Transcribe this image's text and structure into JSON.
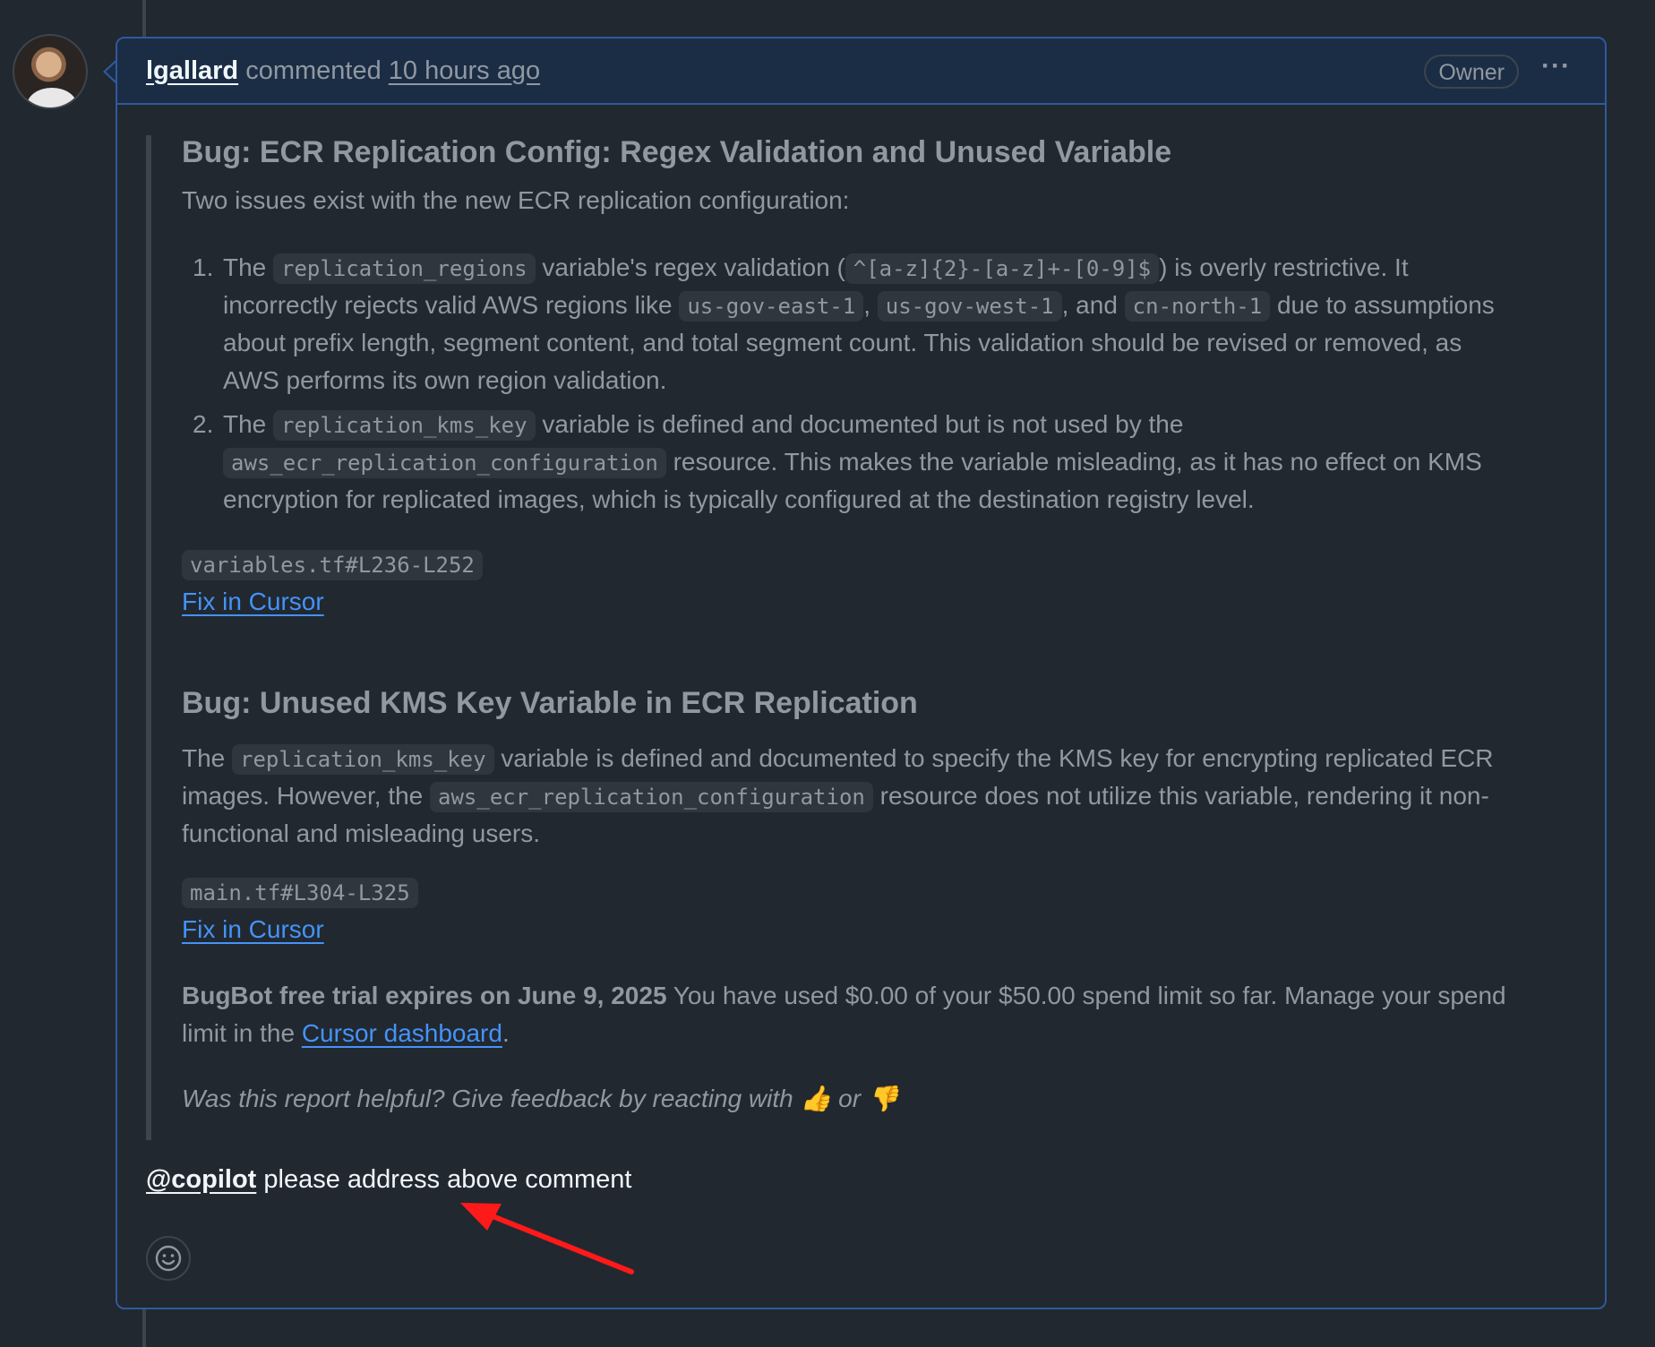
{
  "header": {
    "author": "lgallard",
    "action": "commented",
    "time": "10 hours ago",
    "badge": "Owner",
    "menu_glyph": "···"
  },
  "bug1": {
    "title": "Bug: ECR Replication Config: Regex Validation and Unused Variable",
    "intro": "Two issues exist with the new ECR replication configuration:",
    "item1": {
      "num": "1.",
      "l1_a": "The ",
      "l1_code1": "replication_regions",
      "l1_b": " variable's regex validation (",
      "l1_code2": "^[a-z]{2}-[a-z]+-[0-9]$",
      "l1_c": ") is overly restrictive. It",
      "l2_a": "incorrectly rejects valid AWS regions like ",
      "l2_code1": "us-gov-east-1",
      "l2_b": ", ",
      "l2_code2": "us-gov-west-1",
      "l2_c": ", and ",
      "l2_code3": "cn-north-1",
      "l2_d": " due to assumptions",
      "l3": "about prefix length, segment content, and total segment count. This validation should be revised or removed, as",
      "l4": "AWS performs its own region validation."
    },
    "item2": {
      "num": "2.",
      "l1_a": "The ",
      "l1_code": "replication_kms_key",
      "l1_b": " variable is defined and documented but is not used by the",
      "l2_code": "aws_ecr_replication_configuration",
      "l2_b": " resource. This makes the variable misleading, as it has no effect on KMS",
      "l3": "encryption for replicated images, which is typically configured at the destination registry level."
    },
    "file_ref": "variables.tf#L236-L252",
    "fix_link": "Fix in Cursor"
  },
  "bug2": {
    "title": "Bug: Unused KMS Key Variable in ECR Replication",
    "l1_a": "The ",
    "l1_code": "replication_kms_key",
    "l1_b": " variable is defined and documented to specify the KMS key for encrypting replicated ECR",
    "l2_a": "images. However, the ",
    "l2_code": "aws_ecr_replication_configuration",
    "l2_b": " resource does not utilize this variable, rendering it non-",
    "l3": "functional and misleading users.",
    "file_ref": "main.tf#L304-L325",
    "fix_link": "Fix in Cursor"
  },
  "trial": {
    "bold": "BugBot free trial expires on June 9, 2025",
    "l1_rest": " You have used $0.00 of your $50.00 spend limit so far. Manage your spend",
    "l2_a": "limit in the ",
    "l2_link": "Cursor dashboard",
    "l2_b": "."
  },
  "feedback": {
    "text": "Was this report helpful? Give feedback by reacting with ",
    "thumbs_up": "👍",
    "or": " or ",
    "thumbs_down": "👎"
  },
  "reply": {
    "mention": "@copilot",
    "text": " please address above comment"
  },
  "colors": {
    "background": "#212830",
    "header_bg": "#1b2d45",
    "border_accent": "#2f5a9c",
    "link": "#4493f8",
    "annotation_arrow": "#ff1a1a"
  },
  "icons": {
    "reaction": "smiley-icon",
    "annotation": "red-arrow-icon"
  }
}
